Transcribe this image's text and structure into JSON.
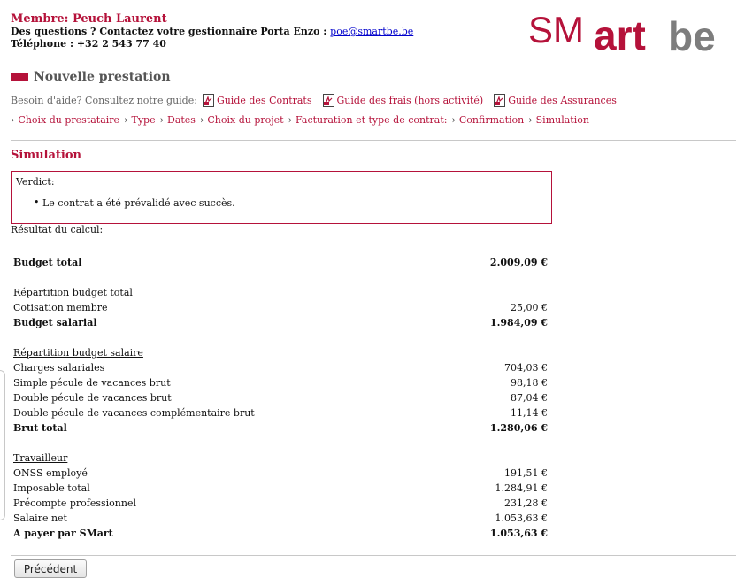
{
  "header": {
    "member_line": "Membre: Peuch Laurent",
    "questions_prefix": "Des questions ? Contactez votre gestionnaire Porta Enzo :",
    "email": "poe@smartbe.be",
    "phone_line": "Téléphone : +32 2 543 77 40",
    "logo_text": {
      "part1": "SM",
      "part2": "art",
      "part3": "be"
    }
  },
  "page": {
    "title": "Nouvelle prestation",
    "help_prefix": "Besoin d'aide? Consultez notre guide:",
    "guides": [
      "Guide des Contrats",
      "Guide des frais (hors activité)",
      "Guide des Assurances"
    ],
    "breadcrumbs": [
      "Choix du prestataire",
      "Type",
      "Dates",
      "Choix du projet",
      "Facturation et type de contrat:",
      "Confirmation",
      "Simulation"
    ],
    "section_title": "Simulation"
  },
  "verdict": {
    "label": "Verdict:",
    "message": "Le contrat a été prévalidé avec succès."
  },
  "result_label": "Résultat du calcul:",
  "calc_rows": [
    {
      "label": "Budget total",
      "value": "2.009,09 €",
      "style": "bold"
    },
    {
      "label": "Répartition budget total",
      "value": "",
      "style": "section"
    },
    {
      "label": "Cotisation membre",
      "value": "25,00 €",
      "style": "normal"
    },
    {
      "label": "Budget salarial",
      "value": "1.984,09 €",
      "style": "bold"
    },
    {
      "label": "Répartition budget salaire",
      "value": "",
      "style": "section"
    },
    {
      "label": "Charges salariales",
      "value": "704,03 €",
      "style": "normal"
    },
    {
      "label": "Simple pécule de vacances brut",
      "value": "98,18 €",
      "style": "normal"
    },
    {
      "label": "Double pécule de vacances brut",
      "value": "87,04 €",
      "style": "normal"
    },
    {
      "label": "Double pécule de vacances complémentaire brut",
      "value": "11,14 €",
      "style": "normal"
    },
    {
      "label": "Brut total",
      "value": "1.280,06 €",
      "style": "bold"
    },
    {
      "label": "Travailleur",
      "value": "",
      "style": "section"
    },
    {
      "label": "ONSS employé",
      "value": "191,51 €",
      "style": "normal"
    },
    {
      "label": "Imposable total",
      "value": "1.284,91 €",
      "style": "normal"
    },
    {
      "label": "Précompte professionnel",
      "value": "231,28 €",
      "style": "normal"
    },
    {
      "label": "Salaire net",
      "value": "1.053,63 €",
      "style": "normal"
    },
    {
      "label": "A payer par SMart",
      "value": "1.053,63 €",
      "style": "bold"
    }
  ],
  "buttons": {
    "previous": "Précédent"
  },
  "colors": {
    "brand": "#b5123a",
    "logo_gray": "#7d7d7d",
    "link": "#0000cc"
  }
}
